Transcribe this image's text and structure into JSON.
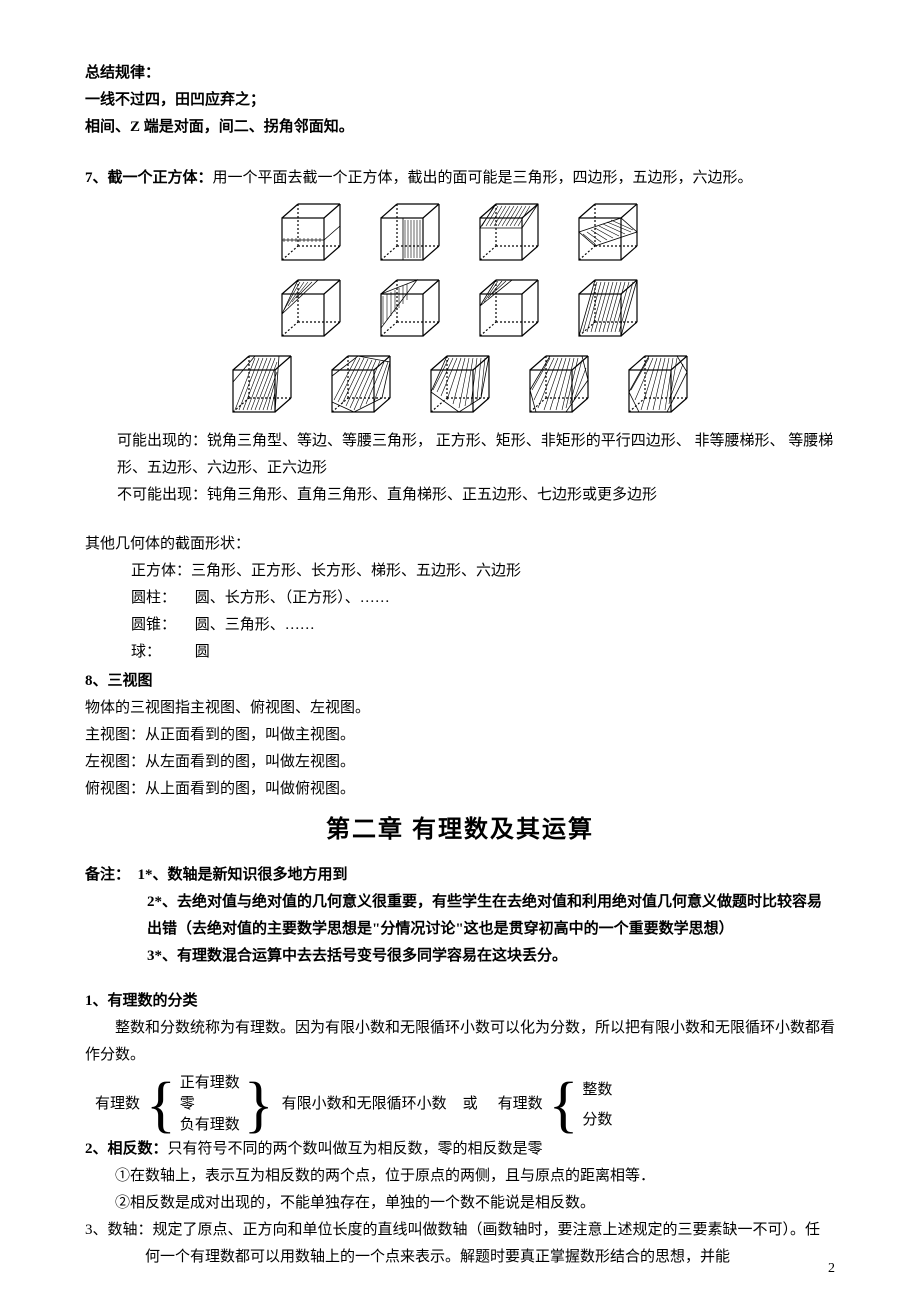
{
  "header": {
    "summary_label": "总结规律：",
    "rule_line1": "一线不过四，田凹应弃之；",
    "rule_line2": "相间、Z 端是对面，间二、拐角邻面知。"
  },
  "section7": {
    "num": "7、",
    "title": "截一个正方体：",
    "body": "用一个平面去截一个正方体，截出的面可能是三角形，四边形，五边形，六边形。",
    "possible_label": "可能出现的：",
    "possible_body": "锐角三角型、等边、等腰三角形，  正方形、矩形、非矩形的平行四边形、  非等腰梯形、  等腰梯形、五边形、六边形、正六边形",
    "impossible_label": "不可能出现：",
    "impossible_body": "钝角三角形、直角三角形、直角梯形、正五边形、七边形或更多边形",
    "other_title": "其他几何体的截面形状：",
    "shapes": [
      {
        "label": "正方体：",
        "body": "三角形、正方形、长方形、梯形、五边形、六边形"
      },
      {
        "label": "圆柱：",
        "body": "  圆、长方形、（正方形）、……"
      },
      {
        "label": "圆锥：",
        "body": "  圆、三角形、……"
      },
      {
        "label": "球：",
        "body": "    圆"
      }
    ]
  },
  "section8": {
    "num": "8、",
    "title": "三视图",
    "lines": [
      "物体的三视图指主视图、俯视图、左视图。",
      "主视图：从正面看到的图，叫做主视图。",
      "左视图：从左面看到的图，叫做左视图。",
      "俯视图：从上面看到的图，叫做俯视图。"
    ]
  },
  "chapter2": {
    "title": "第二章    有理数及其运算",
    "note_label": "备注：",
    "notes": [
      {
        "num": "1*、",
        "body": "数轴是新知识很多地方用到"
      },
      {
        "num": "2*、",
        "body": "去绝对值与绝对值的几何意义很重要，有些学生在去绝对值和利用绝对值几何意义做题时比较容易出错（去绝对值的主要数学思想是\"分情况讨论\"这也是贯穿初高中的一个重要数学思想）"
      },
      {
        "num": "3*、",
        "body": "有理数混合运算中去去括号变号很多同学容易在这块丢分。"
      }
    ]
  },
  "item1": {
    "num": "1、",
    "title": "有理数的分类",
    "body": "整数和分数统称为有理数。因为有限小数和无限循环小数可以化为分数，所以把有限小数和无限循环小数都看作分数。",
    "bracket": {
      "left_label": "有理数",
      "left_items": [
        "正有理数",
        "零",
        "负有理数"
      ],
      "mid_text": "有限小数和无限循环小数",
      "or_text": "或",
      "right_label": "有理数",
      "right_items": [
        "整数",
        "分数"
      ]
    }
  },
  "item2": {
    "num": "2、",
    "title": "相反数：",
    "body": "只有符号不同的两个数叫做互为相反数，零的相反数是零",
    "sub1": "①在数轴上，表示互为相反数的两个点，位于原点的两侧，且与原点的距离相等．",
    "sub2": "②相反数是成对出现的，不能单独存在，单独的一个数不能说是相反数。"
  },
  "item3": {
    "num": "3、",
    "title": "数轴：",
    "body": "规定了原点、正方向和单位长度的直线叫做数轴（画数轴时，要注意上述规定的三要素缺一不可）。任何一个有理数都可以用数轴上的一个点来表示。解题时要真正掌握数形结合的思想，并能"
  },
  "page_num": "2"
}
